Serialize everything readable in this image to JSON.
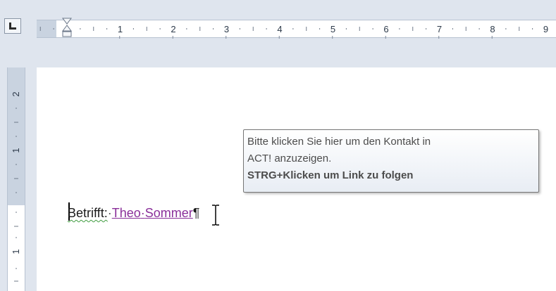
{
  "tooltip": {
    "line1": "Bitte klicken Sie hier um den Kontakt in",
    "line2": "ACT! anzuzeigen.",
    "line3": "STRG+Klicken um Link zu folgen"
  },
  "document": {
    "label_text": "Betrifft:",
    "separator": "·",
    "link_first": "Theo",
    "link_sep": "·",
    "link_last": "Sommer",
    "paragraph_mark": "¶"
  },
  "horizontal_ruler": {
    "numbers": [
      "1",
      "2",
      "3",
      "4",
      "5",
      "6",
      "7",
      "8",
      "9"
    ]
  },
  "vertical_ruler": {
    "numbers": [
      "2",
      "1",
      "1"
    ]
  },
  "colors": {
    "link": "#8a2f9a",
    "grammar_squiggle": "#3f9c3f",
    "ruler_margin": "#c9d3e0",
    "chrome": "#dfe5ee"
  },
  "icons": {
    "tab_selector": "left-tab-stop-icon",
    "indent": "hanging-indent-marker-icon",
    "cursor": "i-beam-cursor-icon"
  }
}
